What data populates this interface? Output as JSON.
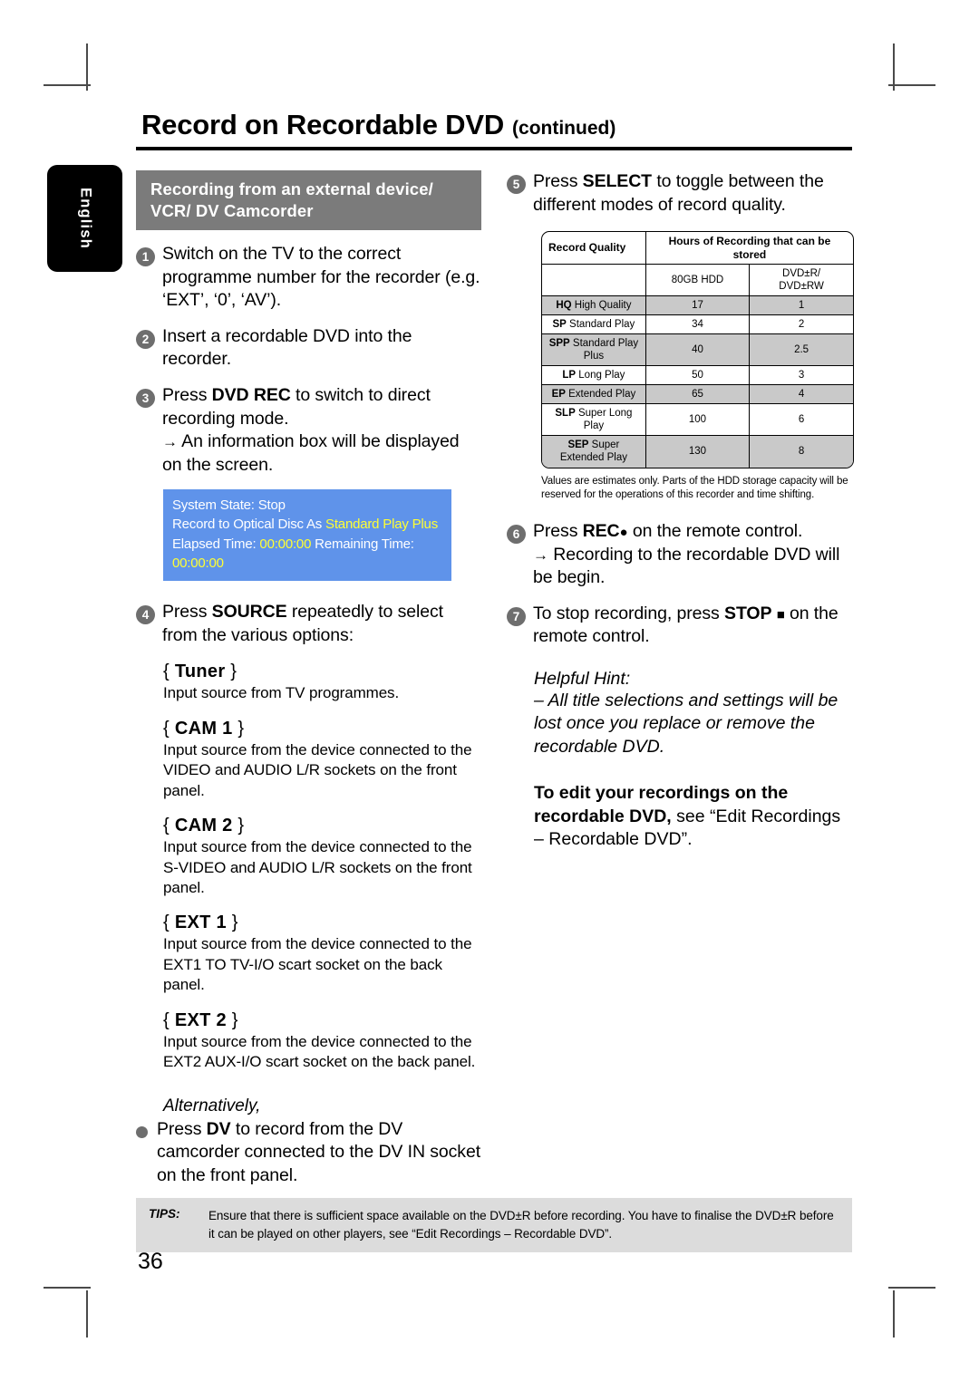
{
  "page": {
    "title_main": "Record on Recordable DVD",
    "title_sub": "(continued)",
    "language_tab": "English",
    "page_number": "36"
  },
  "left_column": {
    "banner": "Recording from an external device/ VCR/ DV Camcorder",
    "steps": [
      {
        "num": "1",
        "text": "Switch on the TV to the correct programme number for the recorder (e.g. ‘EXT’, ‘0’, ‘AV’)."
      },
      {
        "num": "2",
        "text": "Insert a recordable DVD into the recorder."
      },
      {
        "num": "3",
        "text_before": "Press ",
        "bold": "DVD REC",
        "text_after": " to switch to direct recording mode.",
        "result": "An information box will be displayed on the screen."
      },
      {
        "num": "4",
        "text_before": "Press ",
        "bold": "SOURCE",
        "text_after": " repeatedly to select from the various options:"
      }
    ],
    "osd_box": {
      "line1": "System State: Stop",
      "line2_prefix": "Record to Optical Disc As ",
      "line2_highlight": "Standard Play Plus",
      "line3_label1": "Elapsed Time: ",
      "line3_value1": "00:00:00",
      "line3_label2": " Remaining Time: ",
      "line3_value2": "00:00:00"
    },
    "source_options": [
      {
        "name": "Tuner",
        "desc": "Input source from TV programmes."
      },
      {
        "name": "CAM 1",
        "desc": "Input source from the device connected to the VIDEO and AUDIO L/R sockets on the front panel."
      },
      {
        "name": "CAM 2",
        "desc": "Input source from the device connected to the S-VIDEO and AUDIO L/R sockets on the front panel."
      },
      {
        "name": "EXT 1",
        "desc": "Input source from the device connected to the EXT1 TO TV-I/O scart socket on the back panel."
      },
      {
        "name": "EXT 2",
        "desc": "Input source from the device connected to the EXT2 AUX-I/O scart socket on the back panel."
      }
    ],
    "alternatively_label": "Alternatively,",
    "alternatively_step": {
      "text_before": "Press ",
      "bold": "DV",
      "text_after": " to record from the DV camcorder connected to the DV IN socket on the front panel."
    }
  },
  "right_column": {
    "steps": [
      {
        "num": "5",
        "text_before": "Press ",
        "bold": "SELECT",
        "text_after": " to toggle between the different modes of record quality."
      },
      {
        "num": "6",
        "text_before": "Press ",
        "bold": "REC",
        "icon": "record-dot-icon",
        "text_after": " on the remote control.",
        "result": "Recording to the recordable DVD will be begin."
      },
      {
        "num": "7",
        "text_before": "To stop recording, press ",
        "bold": "STOP",
        "icon": "stop-square-icon",
        "text_after": " on the remote control."
      }
    ],
    "hint_title": "Helpful Hint:",
    "hint_body": "– All title selections and settings will be lost once you replace or remove the recordable DVD.",
    "edit_note": {
      "bold1": "To edit your recordings on the recordable DVD,",
      "rest": " see “Edit Recordings – Recordable DVD”."
    },
    "table_note": "Values are estimates only. Parts of the HDD storage capacity will be reserved for the operations of this recorder and time shifting."
  },
  "chart_data": {
    "type": "table",
    "title": "Record Quality",
    "header_left": "Record Quality",
    "header_right": "Hours of Recording that can be stored",
    "sub_headers": [
      "80GB HDD",
      "DVD±R/\nDVD±RW"
    ],
    "sub_header_hdd": "80GB HDD",
    "sub_header_dvd_line1": "DVD±R/",
    "sub_header_dvd_line2": "DVD±RW",
    "categories": [
      "HQ High Quality",
      "SP Standard Play",
      "SPP Standard Play Plus",
      "LP Long Play",
      "EP Extended Play",
      "SLP Super Long Play",
      "SEP Super Extended Play"
    ],
    "rows": [
      {
        "abbr": "HQ",
        "name": " High Quality",
        "hdd": "17",
        "dvd": "1",
        "shaded": true
      },
      {
        "abbr": "SP",
        "name": " Standard Play",
        "hdd": "34",
        "dvd": "2",
        "shaded": false
      },
      {
        "abbr": "SPP",
        "name": " Standard Play Plus",
        "hdd": "40",
        "dvd": "2.5",
        "shaded": true
      },
      {
        "abbr": "LP",
        "name": " Long Play",
        "hdd": "50",
        "dvd": "3",
        "shaded": false
      },
      {
        "abbr": "EP",
        "name": " Extended Play",
        "hdd": "65",
        "dvd": "4",
        "shaded": true
      },
      {
        "abbr": "SLP",
        "name": " Super Long Play",
        "hdd": "100",
        "dvd": "6",
        "shaded": false
      },
      {
        "abbr": "SEP",
        "name": " Super Extended Play",
        "hdd": "130",
        "dvd": "8",
        "shaded": true
      }
    ],
    "series": [
      {
        "name": "80GB HDD",
        "values": [
          17,
          34,
          40,
          50,
          65,
          100,
          130
        ]
      },
      {
        "name": "DVD±R/DVD±RW",
        "values": [
          1,
          2,
          2.5,
          3,
          4,
          6,
          8
        ]
      }
    ],
    "ylabel": "Hours of Recording that can be stored",
    "xlabel": "Record Quality",
    "grid": true
  },
  "tips": {
    "label": "TIPS:",
    "text": "Ensure that there is sufficient space available on the DVD±R before recording. You have to finalise the DVD±R before it can be played on other players, see “Edit Recordings – Recordable DVD”."
  },
  "colors": {
    "banner_gray": "#7b7b7b",
    "osd_blue": "#5f93ea",
    "osd_highlight": "#ffff33",
    "tips_gray": "#dcdcdc",
    "table_shade": "#c9c9c9",
    "step_badge": "#6e6e6e"
  }
}
